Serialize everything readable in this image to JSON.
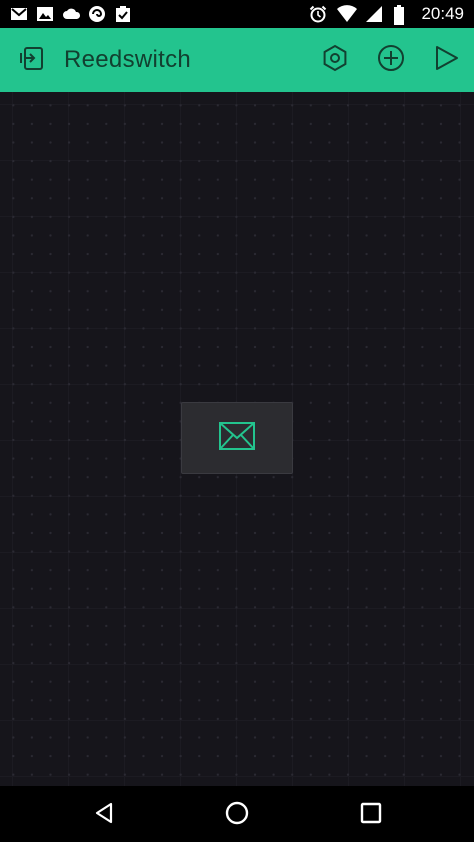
{
  "status_bar": {
    "time": "20:49",
    "left_icons": [
      "gmail-icon",
      "image-icon",
      "cloud-icon",
      "app-icon",
      "clipboard-check-icon"
    ],
    "right_icons": [
      "alarm-icon",
      "wifi-icon",
      "signal-icon",
      "battery-icon"
    ]
  },
  "app_bar": {
    "title": "Reedswitch",
    "background_color": "#23c48e",
    "icons": [
      "exit-icon",
      "settings-icon",
      "add-icon",
      "play-icon"
    ]
  },
  "canvas": {
    "widget_icon": "email-icon",
    "accent_color": "#23c48e"
  },
  "nav_bar": {
    "icons": [
      "back-icon",
      "home-icon",
      "recents-icon"
    ]
  }
}
